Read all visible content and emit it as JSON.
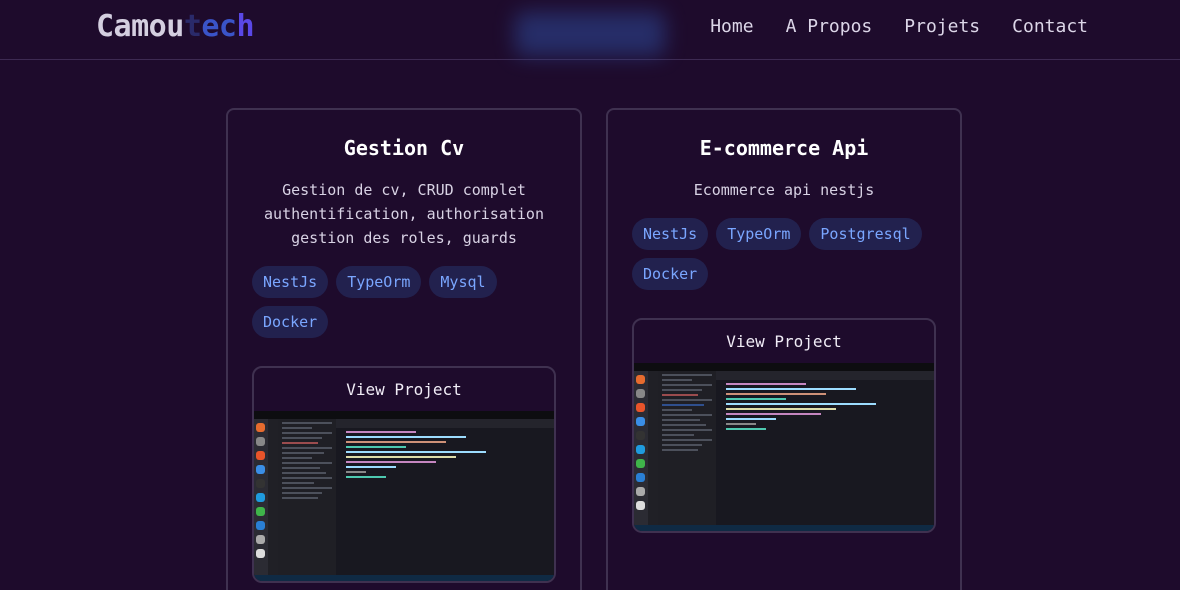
{
  "header": {
    "logo": {
      "part1": "Camou",
      "part2": "t",
      "part3": "ec",
      "part4": "h"
    },
    "nav": [
      "Home",
      "A Propos",
      "Projets",
      "Contact"
    ]
  },
  "projects": [
    {
      "title": "Gestion Cv",
      "description": "Gestion de cv, CRUD complet authentification, authorisation gestion des roles, guards",
      "tags": [
        "NestJs",
        "TypeOrm",
        "Mysql",
        "Docker"
      ],
      "view_label": "View Project",
      "preview_icon": "vscode-screenshot"
    },
    {
      "title": "E-commerce Api",
      "description": "Ecommerce api nestjs",
      "tags": [
        "NestJs",
        "TypeOrm",
        "Postgresql",
        "Docker"
      ],
      "view_label": "View Project",
      "preview_icon": "vscode-screenshot"
    }
  ],
  "colors": {
    "background": "#1e0b2c",
    "tag_bg": "#22214e",
    "tag_text": "#7aa6ff",
    "border": "#3f3150"
  }
}
